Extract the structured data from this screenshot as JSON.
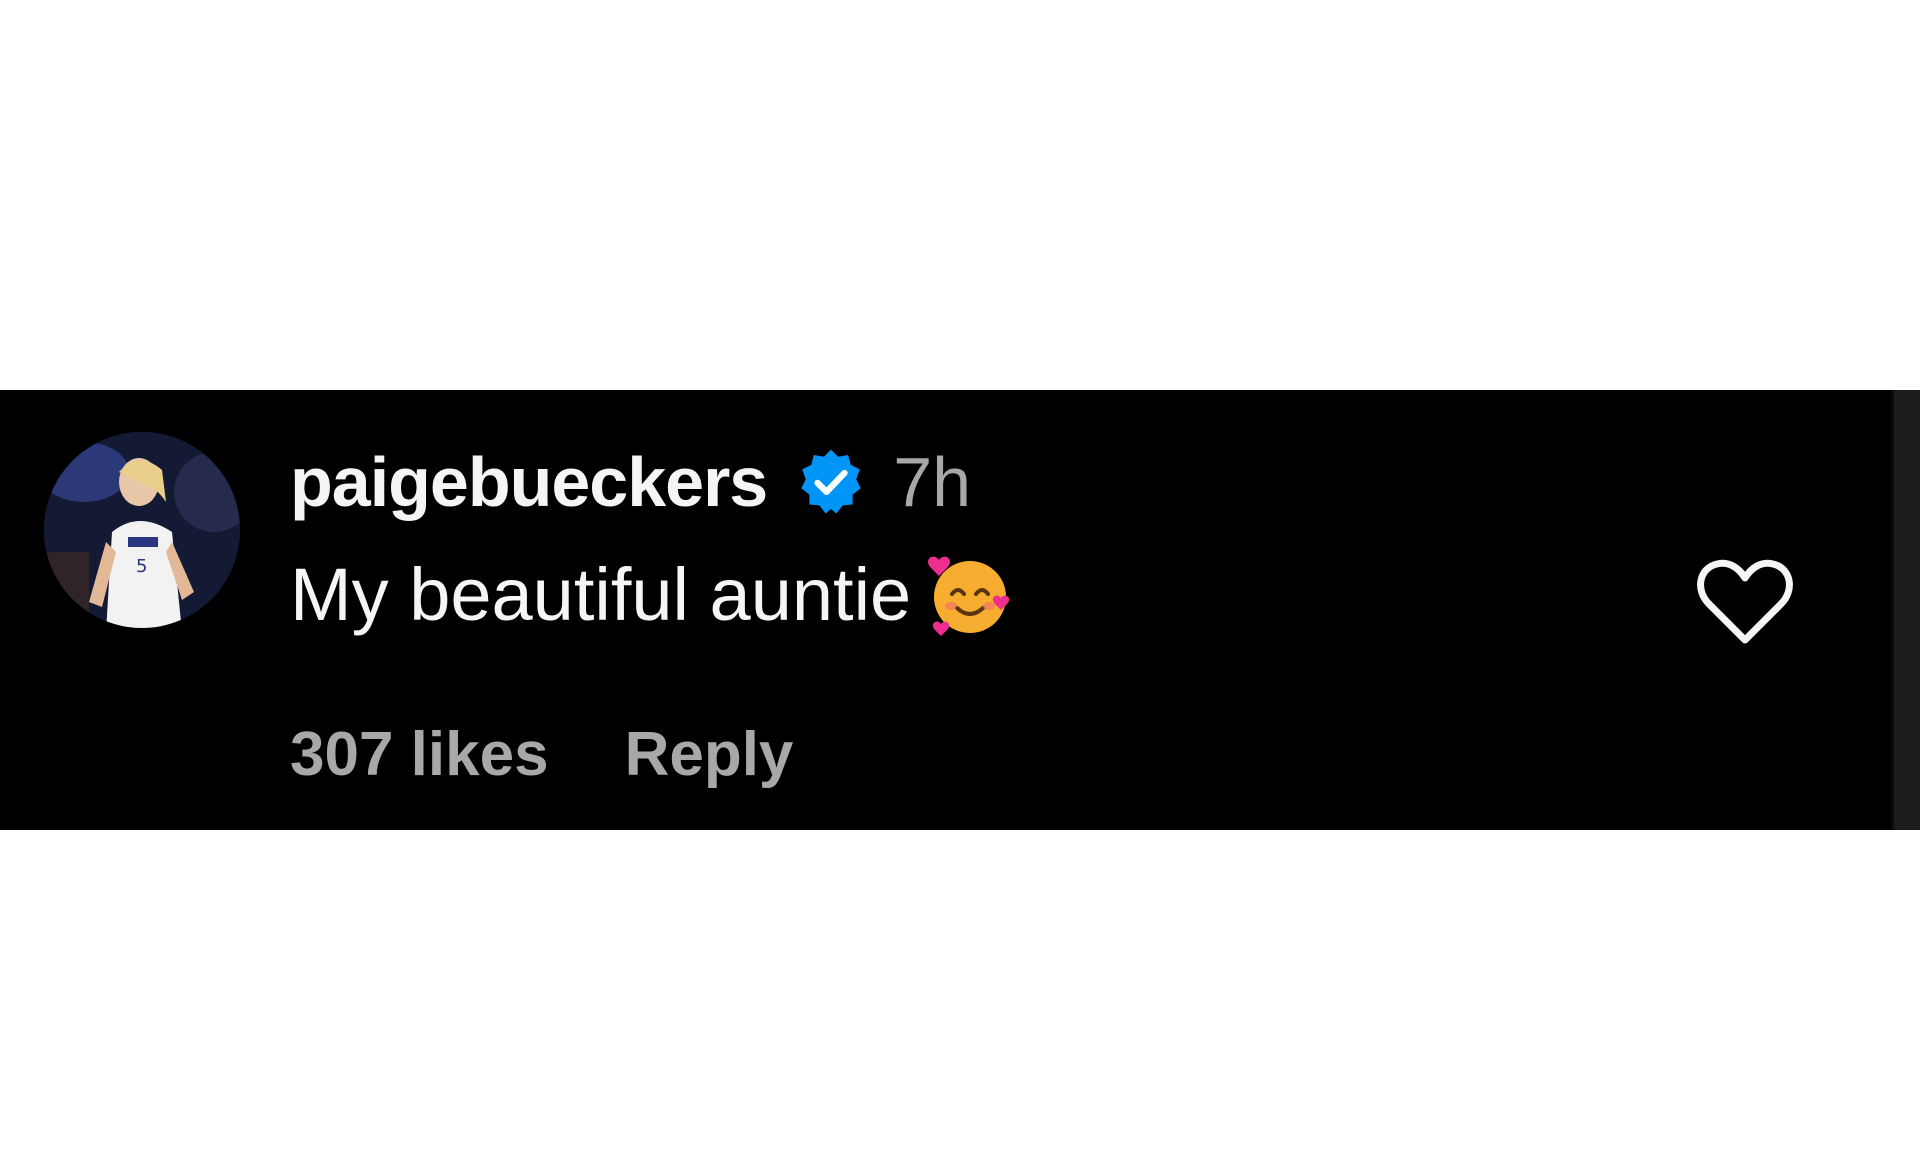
{
  "comment": {
    "username": "paigebueckers",
    "verified": true,
    "time": "7h",
    "text": "My beautiful auntie",
    "emoji": "smiling-face-with-hearts-emoji",
    "likes": "307 likes",
    "reply_label": "Reply"
  },
  "icons": {
    "verified": "verified-badge-icon",
    "like": "heart-outline-icon"
  },
  "colors": {
    "background": "#000000",
    "username": "#f5f5f5",
    "secondary_text": "#a8a8a8",
    "verified_blue": "#0095f6"
  }
}
